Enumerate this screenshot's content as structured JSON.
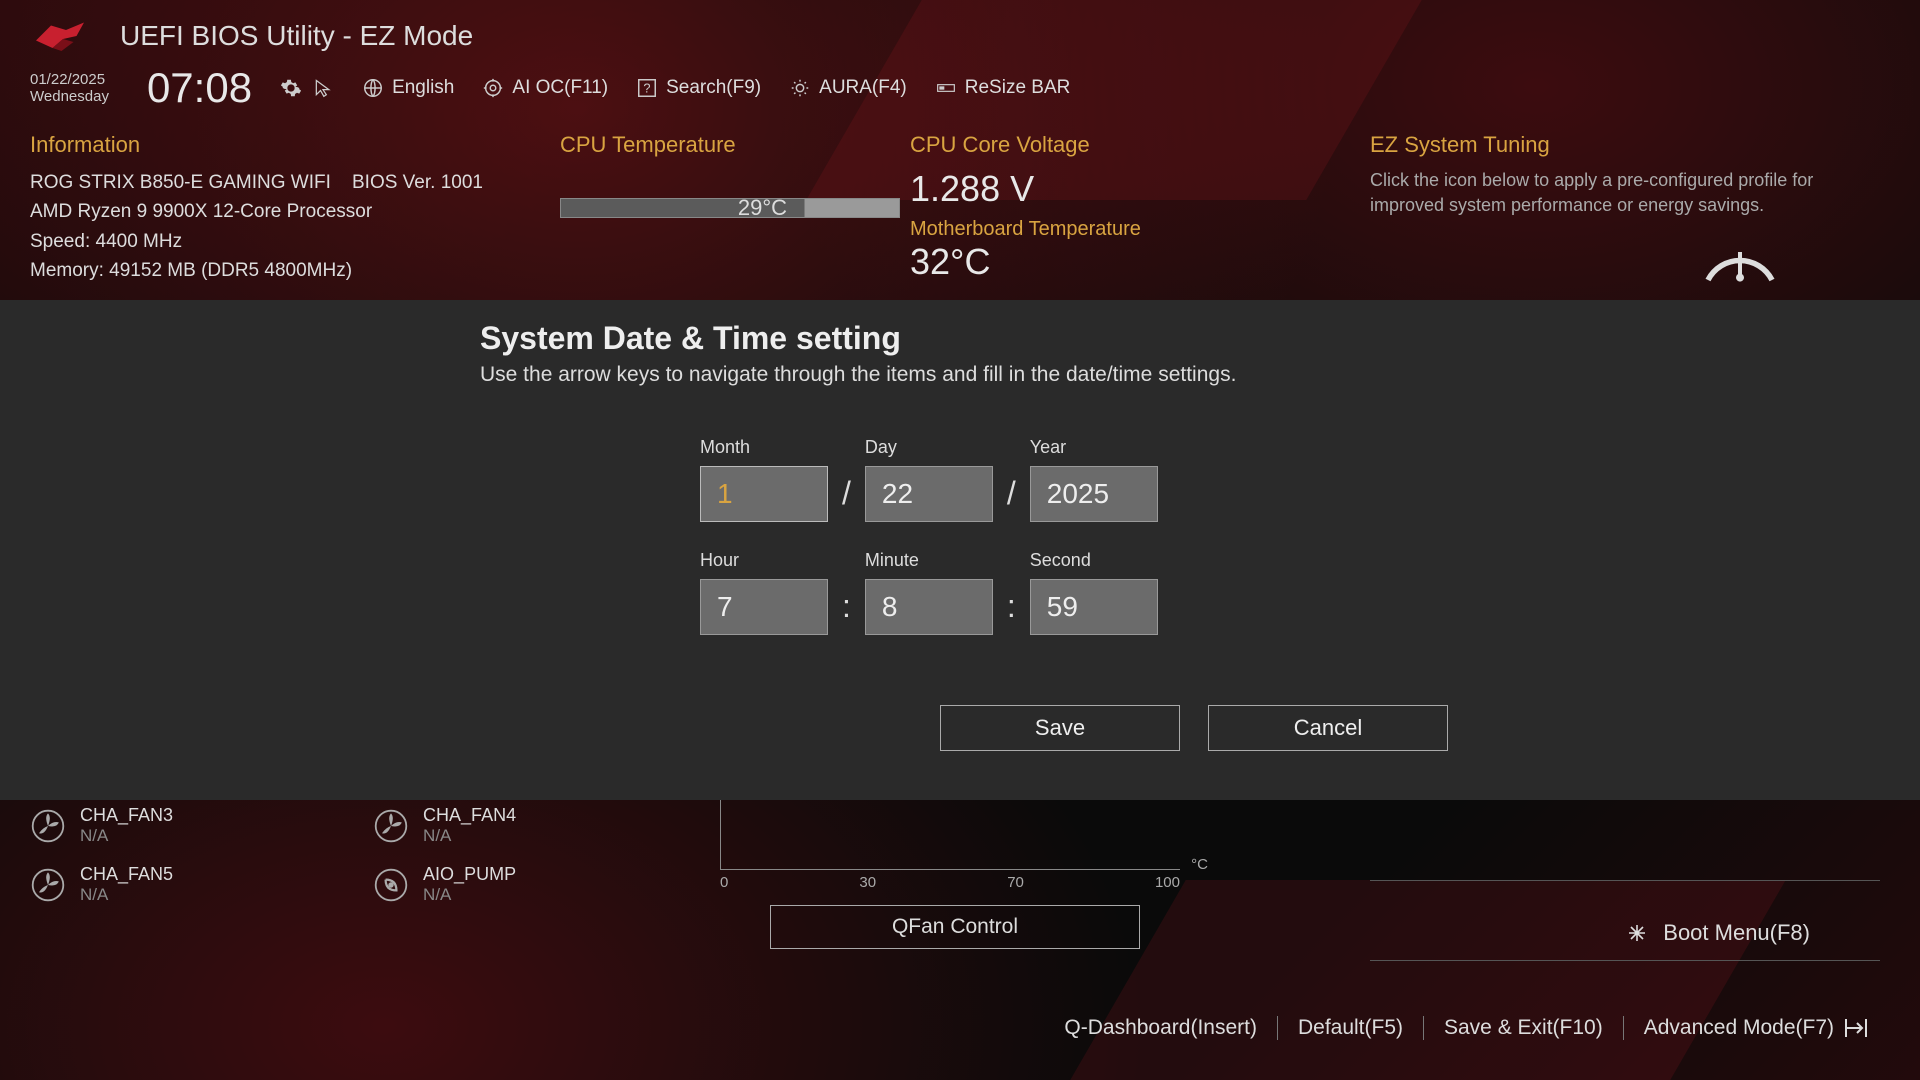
{
  "header": {
    "title": "UEFI BIOS Utility - EZ Mode"
  },
  "datetime": {
    "date": "01/22/2025",
    "day": "Wednesday",
    "clock": "07:08"
  },
  "topbar": {
    "language": "English",
    "ai_oc": "AI OC(F11)",
    "search": "Search(F9)",
    "aura": "AURA(F4)",
    "resize_bar": "ReSize BAR"
  },
  "information": {
    "label": "Information",
    "board": "ROG STRIX B850-E GAMING WIFI",
    "bios_ver_label": "BIOS Ver. 1001",
    "cpu": "AMD Ryzen 9 9900X 12-Core Processor",
    "speed": "Speed: 4400 MHz",
    "memory": "Memory: 49152 MB (DDR5 4800MHz)"
  },
  "cpu_temp": {
    "label": "CPU Temperature",
    "value": "29°C"
  },
  "voltage": {
    "label": "CPU Core Voltage",
    "value": "1.288 V"
  },
  "mb_temp": {
    "label": "Motherboard Temperature",
    "value": "32°C"
  },
  "tuning": {
    "label": "EZ System Tuning",
    "desc": "Click the icon below to apply a pre-configured profile for improved system performance or energy savings."
  },
  "modal": {
    "title": "System Date & Time setting",
    "subtitle": "Use the arrow keys to navigate through the items and fill in the date/time settings.",
    "labels": {
      "month": "Month",
      "day": "Day",
      "year": "Year",
      "hour": "Hour",
      "minute": "Minute",
      "second": "Second"
    },
    "values": {
      "month": "1",
      "day": "22",
      "year": "2025",
      "hour": "7",
      "minute": "8",
      "second": "59"
    },
    "save": "Save",
    "cancel": "Cancel"
  },
  "fans": {
    "items": [
      {
        "name": "CHA_FAN3",
        "val": "N/A"
      },
      {
        "name": "CHA_FAN5",
        "val": "N/A"
      },
      {
        "name": "CHA_FAN4",
        "val": "N/A"
      },
      {
        "name": "AIO_PUMP",
        "val": "N/A"
      }
    ]
  },
  "chart_ticks": [
    "0",
    "30",
    "70",
    "100"
  ],
  "chart_unit": "°C",
  "qfan_btn": "QFan Control",
  "boot_menu": "Boot Menu(F8)",
  "footer": {
    "qdash": "Q-Dashboard(Insert)",
    "default": "Default(F5)",
    "save_exit": "Save & Exit(F10)",
    "advanced": "Advanced Mode(F7)"
  }
}
